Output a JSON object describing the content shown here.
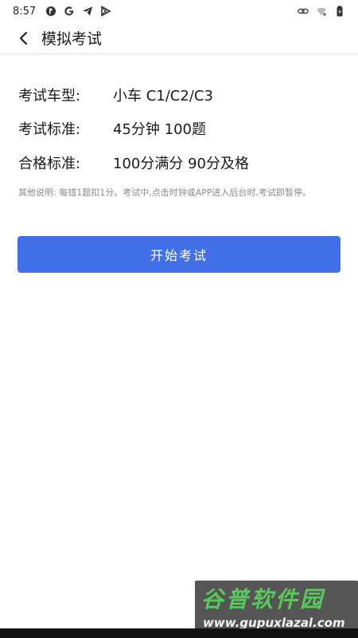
{
  "status_bar": {
    "time": "8:57",
    "left_icons": [
      "clock-badge-icon",
      "google-g-icon",
      "send-icon",
      "play-store-icon"
    ],
    "right_icons": [
      "link-icon",
      "wifi-off-icon",
      "battery-icon"
    ]
  },
  "app_bar": {
    "back_icon": "chevron-left-icon",
    "title": "模拟考试"
  },
  "info": {
    "rows": [
      {
        "label": "考试车型:",
        "value": "小车 C1/C2/C3"
      },
      {
        "label": "考试标准:",
        "value": "45分钟 100题"
      },
      {
        "label": "合格标准:",
        "value": "100分满分 90分及格"
      }
    ],
    "note": "其他说明: 每错1题扣1分。考试中,点击时钟或APP进入后台时,考试即暂停。"
  },
  "start_button": {
    "label": "开始考试"
  },
  "watermark": {
    "title": "谷普软件园",
    "url": "www.gupuxlazal.com"
  },
  "colors": {
    "primary": "#4270e8",
    "note_text": "#8a8a8a",
    "watermark_green": "#58c95a"
  }
}
